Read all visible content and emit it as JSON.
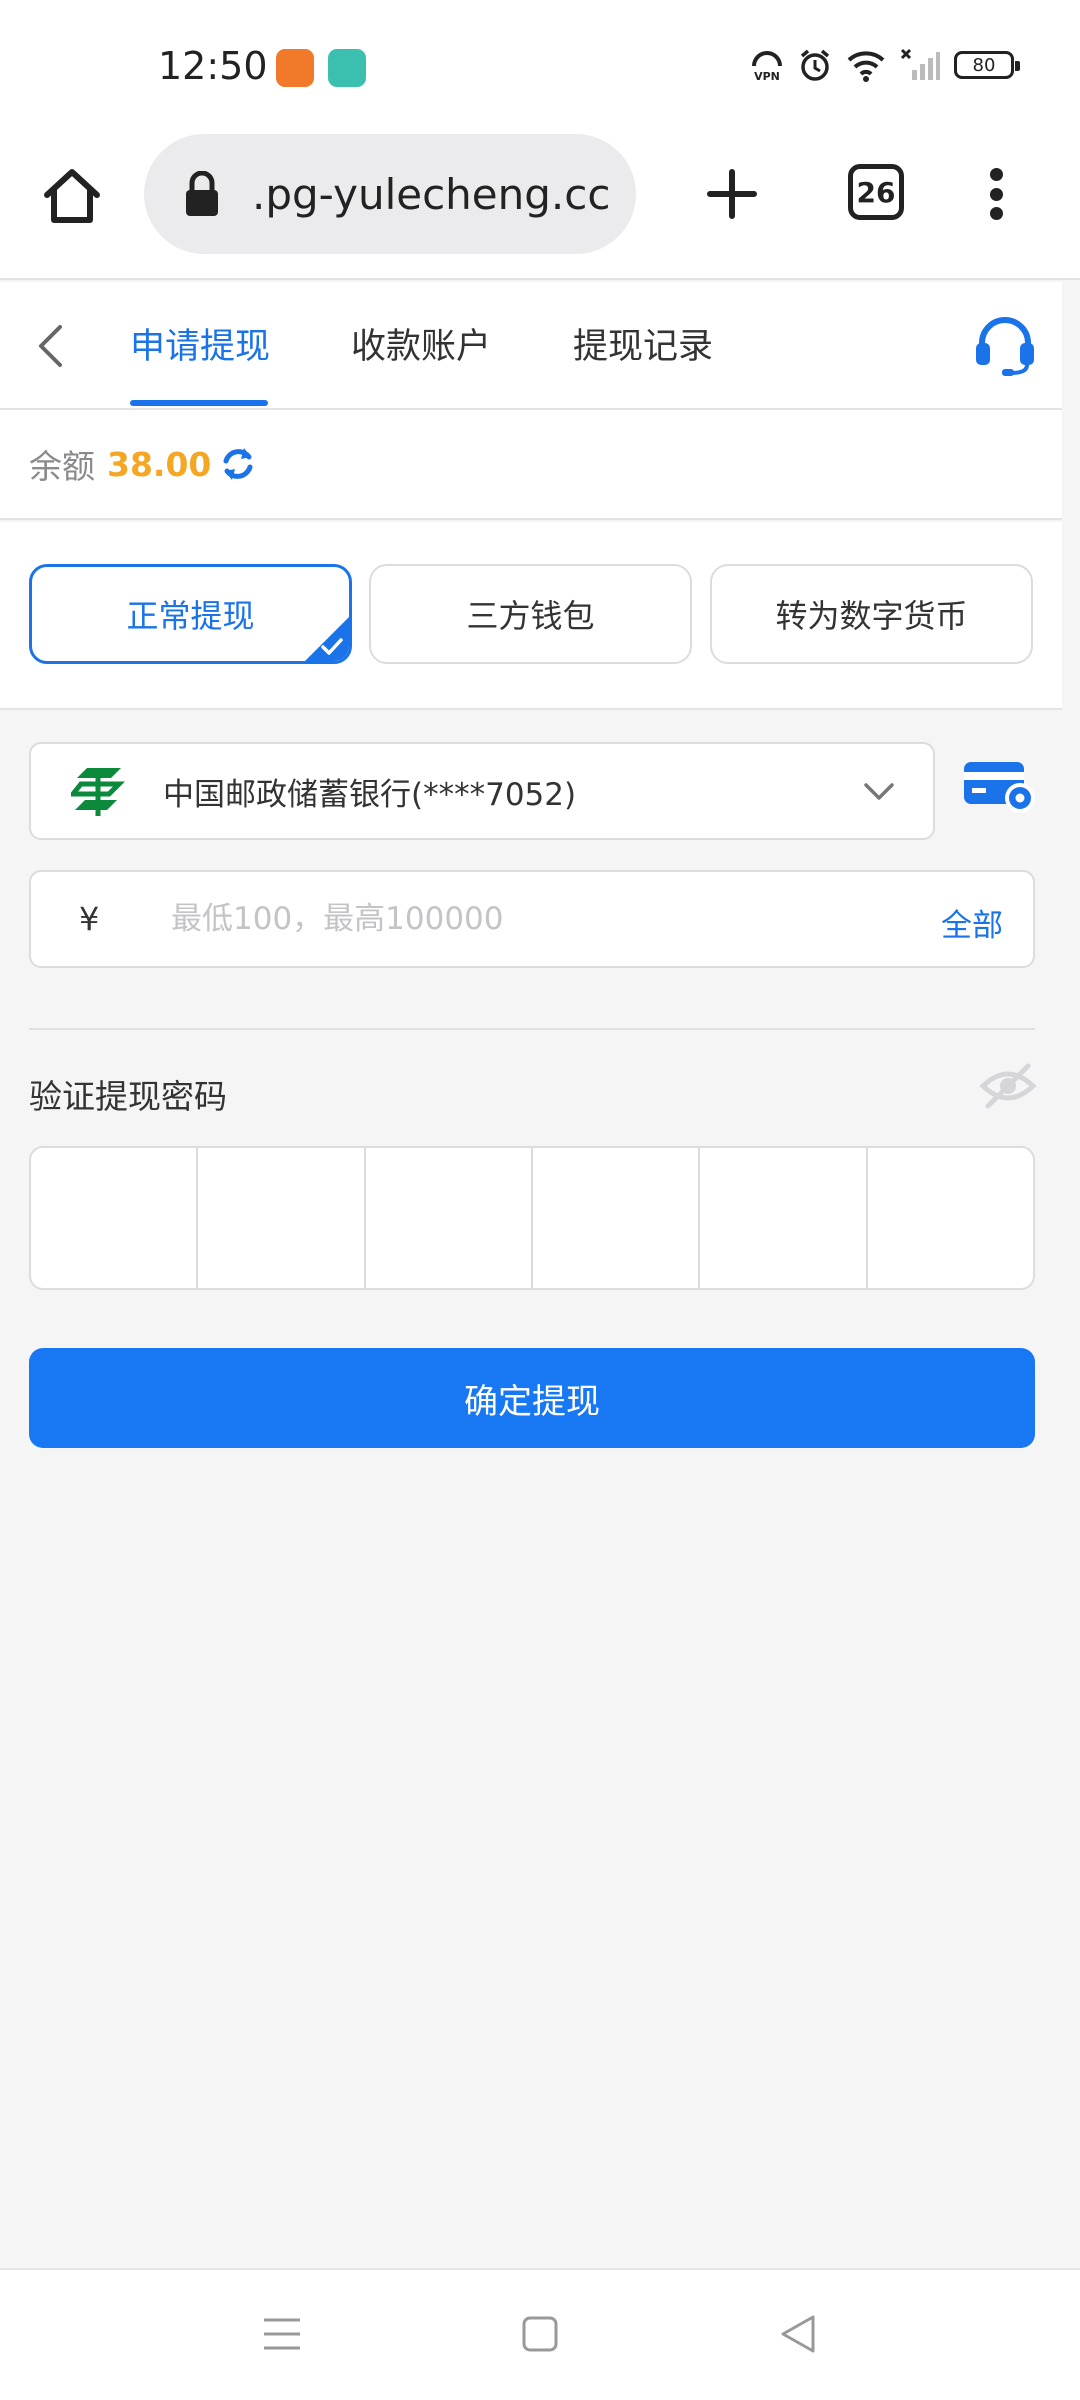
{
  "status_bar": {
    "time": "12:50",
    "battery": "80",
    "icons": [
      "app-notification-icon",
      "chat-notification-icon",
      "vpn-icon",
      "alarm-icon",
      "wifi-icon",
      "signal-icon",
      "battery-icon"
    ]
  },
  "browser": {
    "url": ".pg-yulecheng.cc",
    "tab_count": "26"
  },
  "nav": {
    "tabs": [
      "申请提现",
      "收款账户",
      "提现记录"
    ],
    "active_tab": 0
  },
  "balance": {
    "label": "余额",
    "value": "38.00"
  },
  "methods": {
    "items": [
      "正常提现",
      "三方钱包",
      "转为数字货币"
    ],
    "active": 0
  },
  "bank": {
    "name": "中国邮政储蓄银行(****7052)"
  },
  "amount": {
    "currency": "¥",
    "placeholder": "最低100，最高100000",
    "all_label": "全部"
  },
  "password": {
    "label": "验证提现密码",
    "digits": 6
  },
  "confirm_button": "确定提现",
  "colors": {
    "accent": "#1a73e8",
    "balance": "#f5a623",
    "button": "#1878f3",
    "bank_green": "#0a8a3a"
  }
}
